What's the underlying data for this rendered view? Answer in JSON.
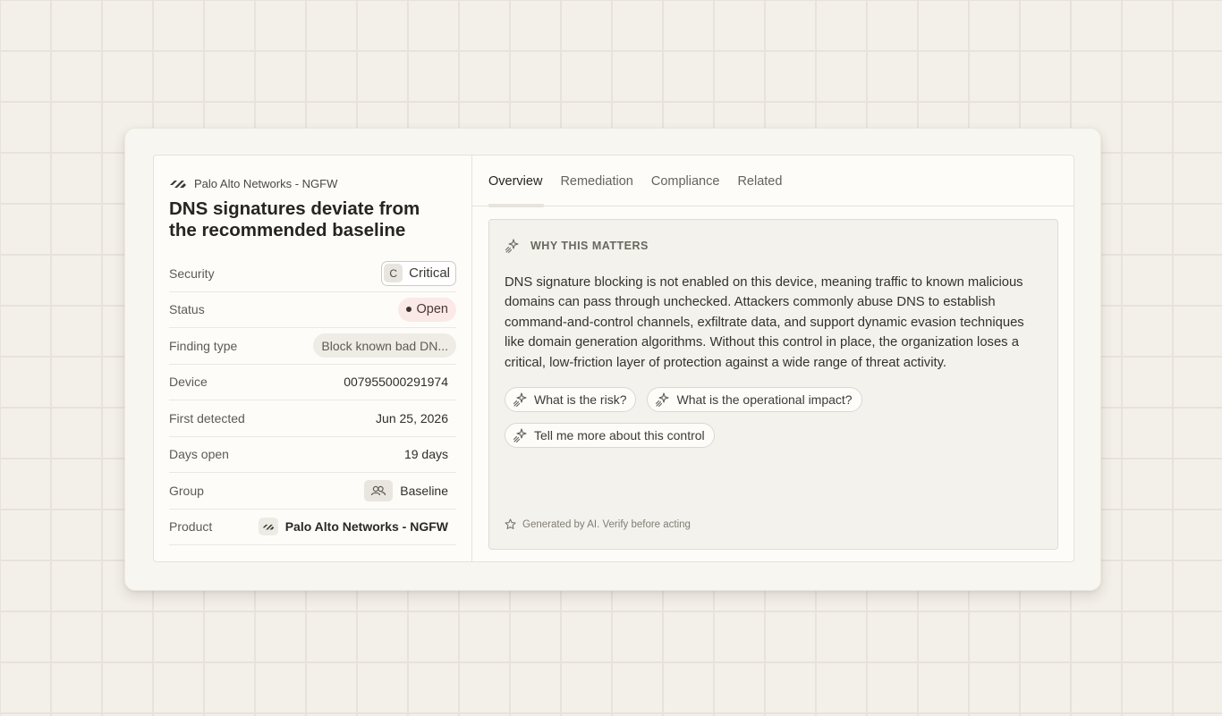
{
  "vendor": {
    "name": "Palo Alto Networks - NGFW",
    "icon": "palo-alto-logo-icon"
  },
  "finding": {
    "title": "DNS signatures deviate from the recommended baseline"
  },
  "properties": {
    "security": {
      "label": "Security",
      "letter": "C",
      "value": "Critical"
    },
    "status": {
      "label": "Status",
      "value": "Open",
      "color": "#fbe9e8"
    },
    "finding_type": {
      "label": "Finding type",
      "value": "Block known bad DN..."
    },
    "device": {
      "label": "Device",
      "value": "007955000291974"
    },
    "first_detected": {
      "label": "First detected",
      "value": "Jun 25, 2026"
    },
    "days_open": {
      "label": "Days open",
      "value": "19 days"
    },
    "group": {
      "label": "Group",
      "value": "Baseline",
      "icon": "users-icon"
    },
    "product": {
      "label": "Product",
      "value": "Palo Alto Networks - NGFW"
    }
  },
  "tabs": [
    {
      "label": "Overview",
      "active": true
    },
    {
      "label": "Remediation",
      "active": false
    },
    {
      "label": "Compliance",
      "active": false
    },
    {
      "label": "Related",
      "active": false
    }
  ],
  "overview": {
    "section_title": "WHY THIS MATTERS",
    "body": "DNS signature blocking is not enabled on this device, meaning traffic to known malicious domains can pass through unchecked. Attackers commonly abuse DNS to establish command-and-control channels, exfiltrate data, and support dynamic evasion techniques like domain generation algorithms. Without this control in place, the organization loses a critical, low-friction layer of protection against a wide range of threat activity.",
    "suggestions": [
      "What is the risk?",
      "What is the operational impact?",
      "Tell me more about this control"
    ],
    "footer": "Generated by AI. Verify before acting"
  }
}
